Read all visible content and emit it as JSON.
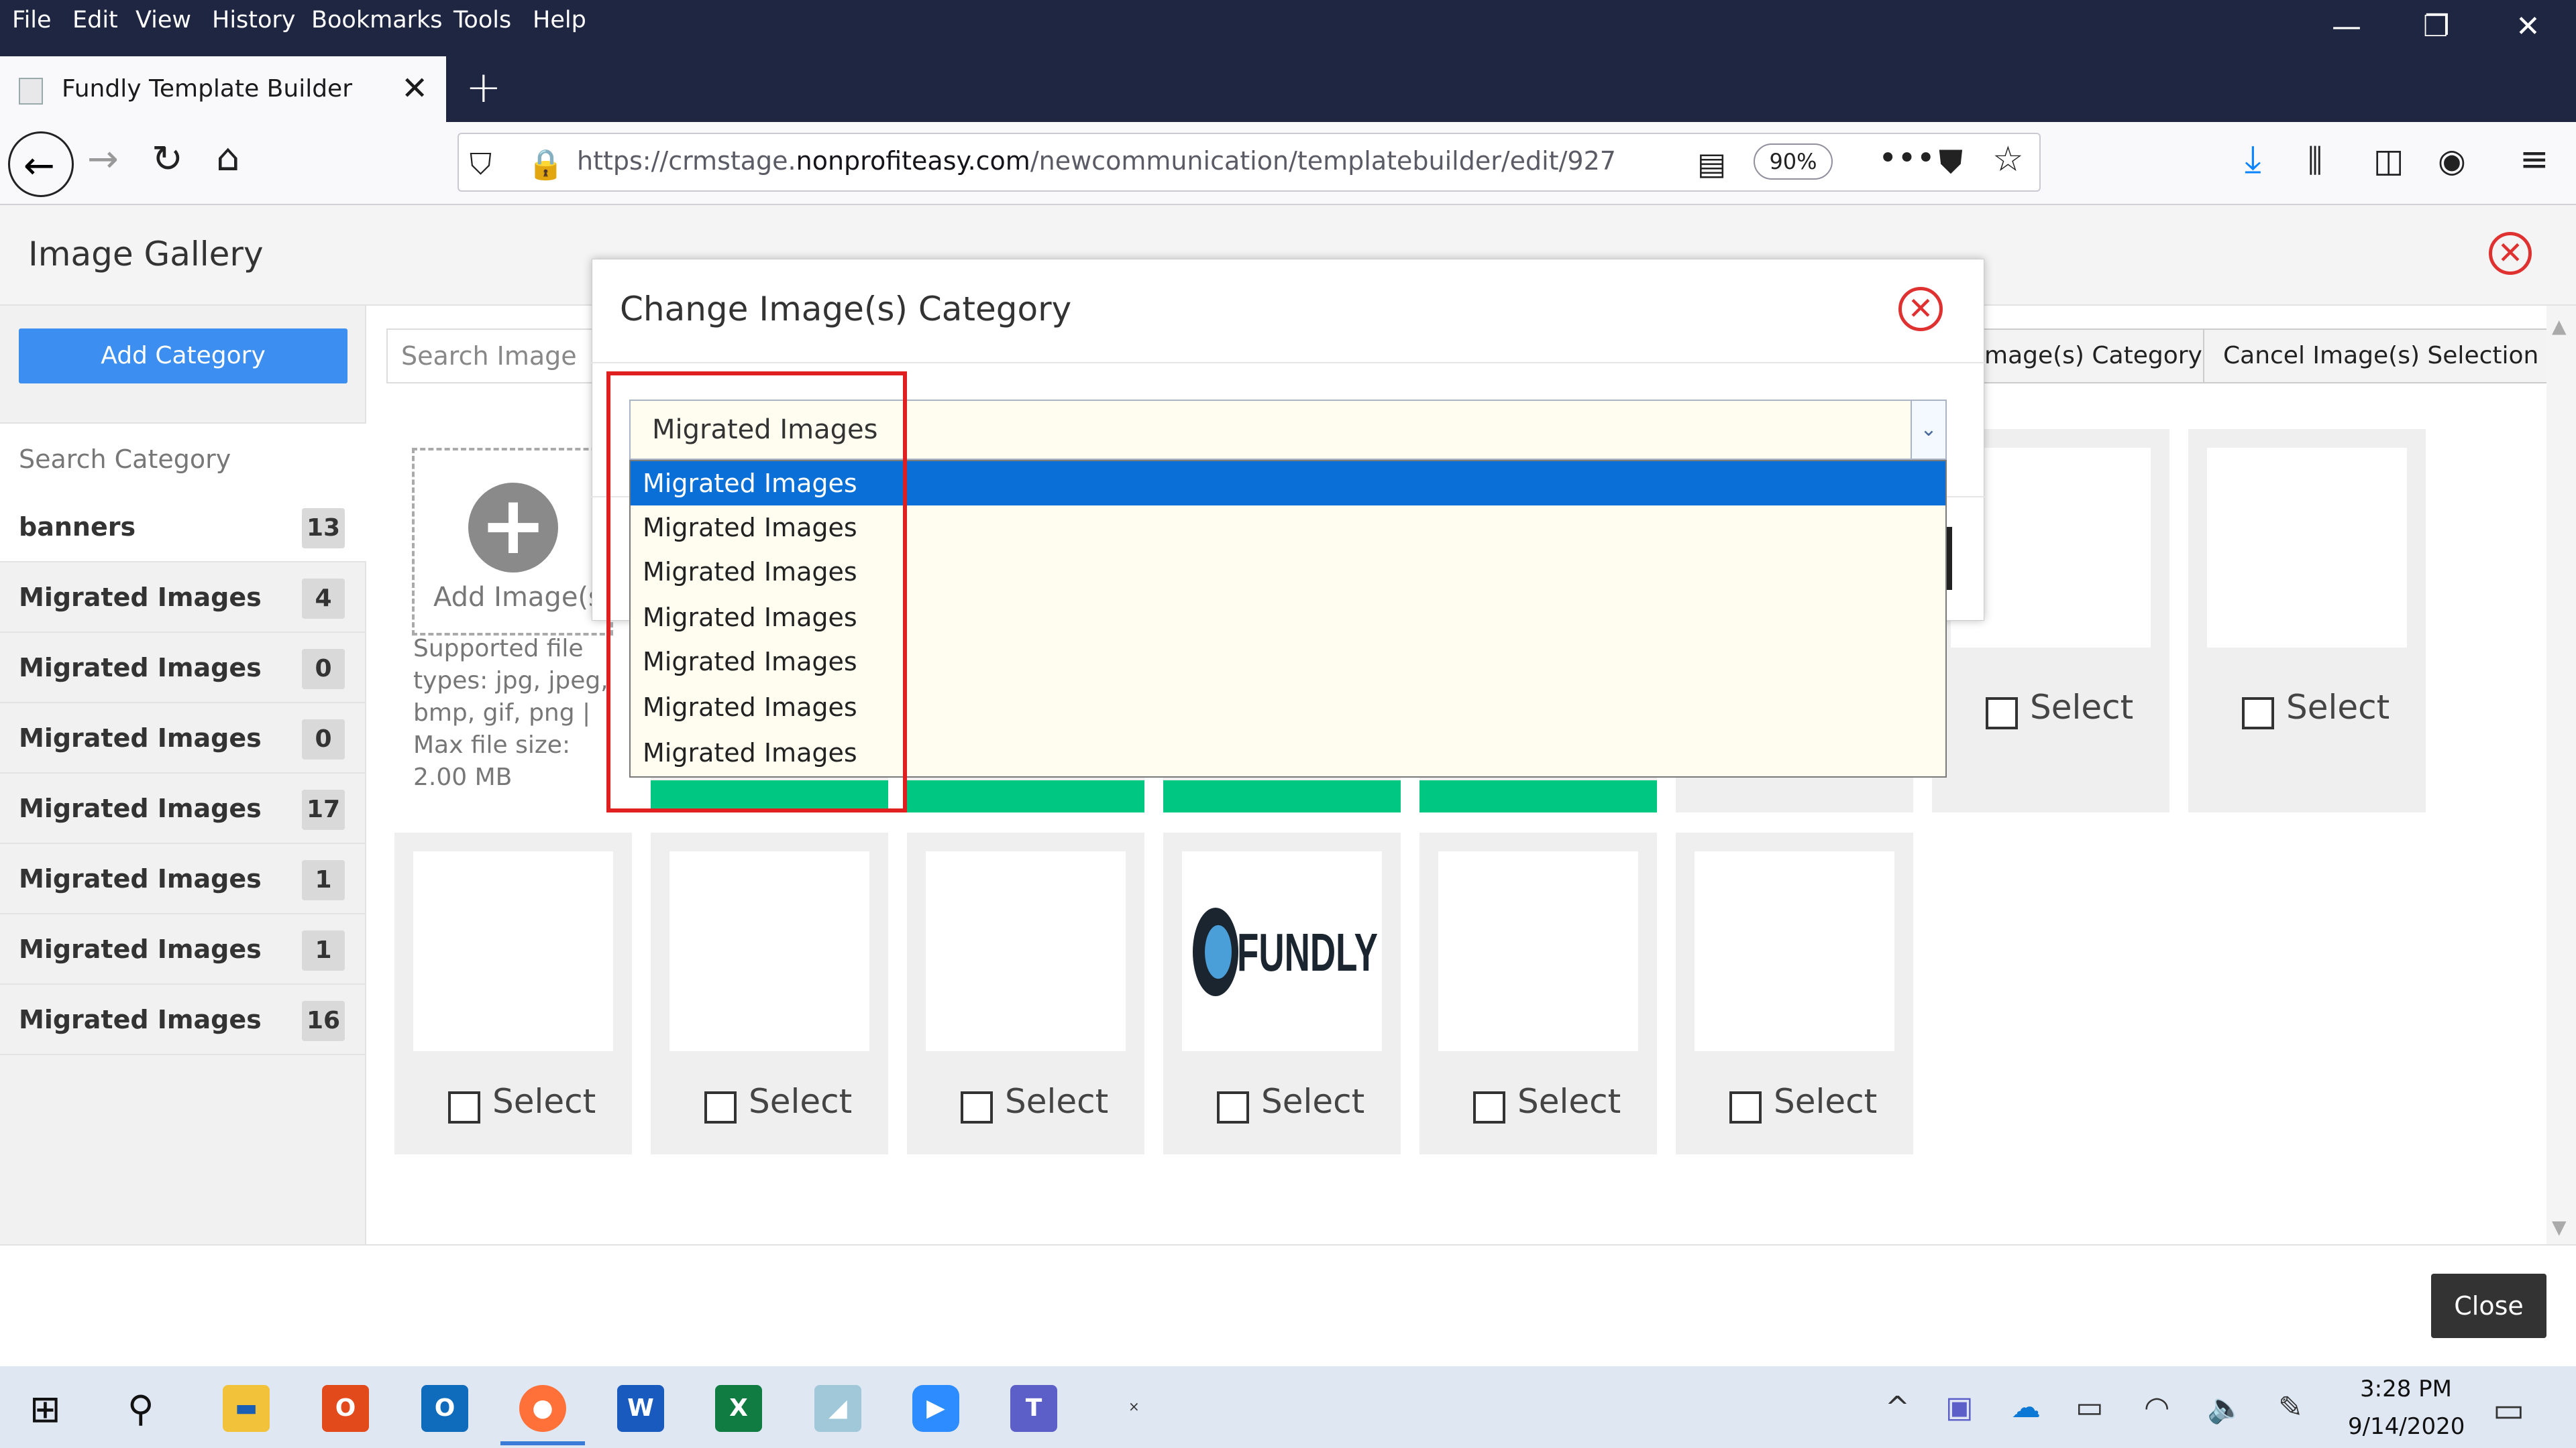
{
  "browser": {
    "menu": [
      "File",
      "Edit",
      "View",
      "History",
      "Bookmarks",
      "Tools",
      "Help"
    ],
    "tab_title": "Fundly Template Builder",
    "url_prefix": "https://crmstage.",
    "url_domain": "nonprofiteasy.com",
    "url_path": "/newcommunication/templatebuilder/edit/927",
    "zoom": "90%"
  },
  "gallery": {
    "title": "Image Gallery",
    "add_category_label": "Add Category",
    "search_category_placeholder": "Search Category",
    "search_image_placeholder": "Search Image",
    "change_category_label": "mage(s) Category",
    "cancel_selection_label": "Cancel Image(s) Selection",
    "categories": [
      {
        "name": "banners",
        "count": "13"
      },
      {
        "name": "Migrated Images",
        "count": "4"
      },
      {
        "name": "Migrated Images",
        "count": "0"
      },
      {
        "name": "Migrated Images",
        "count": "0"
      },
      {
        "name": "Migrated Images",
        "count": "17"
      },
      {
        "name": "Migrated Images",
        "count": "1"
      },
      {
        "name": "Migrated Images",
        "count": "1"
      },
      {
        "name": "Migrated Images",
        "count": "16"
      }
    ],
    "add_images_label": "Add Image(s)",
    "supported_text": "Supported file types: jpg, jpeg, bmp, gif, png | Max file size: 2.00 MB",
    "select_label": "Select",
    "fundly_logo_text": "FUNDLY",
    "close_label": "Close"
  },
  "modal": {
    "title": "Change Image(s) Category",
    "selected_value": "Migrated Images",
    "options": [
      "Migrated Images",
      "Migrated Images",
      "Migrated Images",
      "Migrated Images",
      "Migrated Images",
      "Migrated Images",
      "Migrated Images"
    ]
  },
  "taskbar": {
    "time": "3:28 PM",
    "date": "9/14/2020"
  },
  "colors": {
    "accent_blue": "#3c8ff0",
    "selected_option": "#0a6fd6",
    "green_bar": "#00c882",
    "highlight_red": "#e02020"
  }
}
